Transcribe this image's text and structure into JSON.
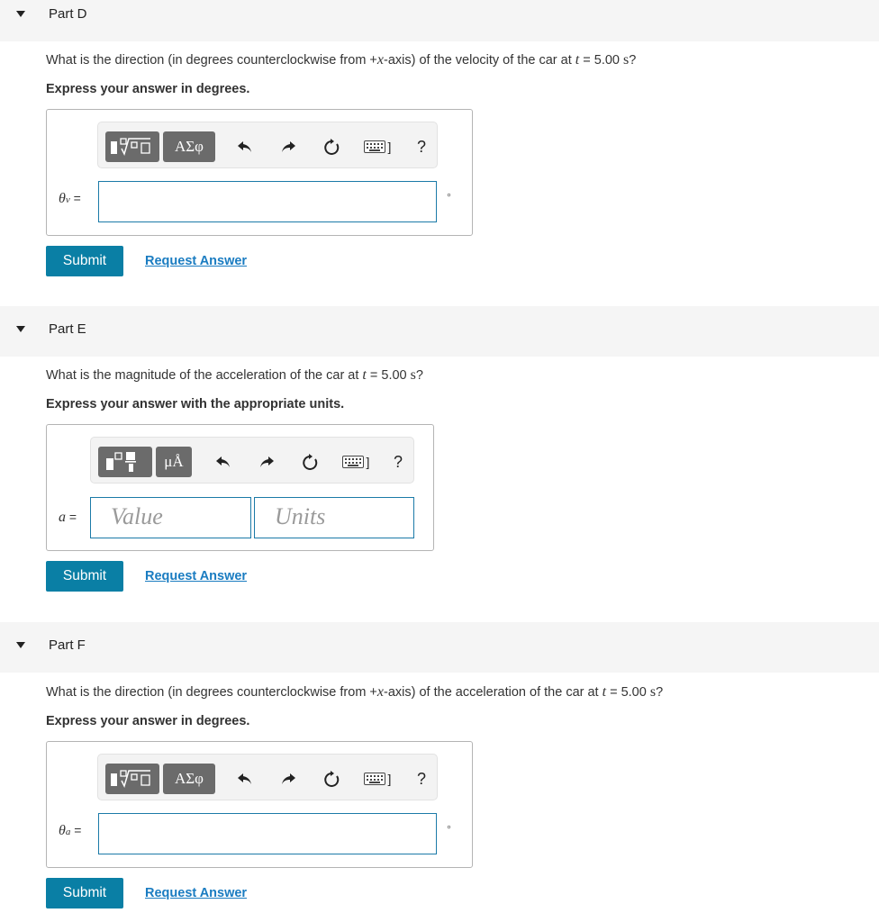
{
  "parts": {
    "d": {
      "title": "Part D",
      "question_pre": "What is the direction (in degrees counterclockwise from +",
      "question_var": "x",
      "question_mid": "-axis) of the velocity of the car at ",
      "question_t": "t",
      "question_eq": " = 5.00 ",
      "question_unit": "s",
      "question_end": "?",
      "instruction": "Express your answer in degrees.",
      "symbol_button": "ΑΣφ",
      "var_symbol": "θ",
      "var_sub": "v",
      "equals": " =",
      "unit_symbol": "∘",
      "submit": "Submit",
      "request": "Request Answer"
    },
    "e": {
      "title": "Part E",
      "question_pre": "What is the magnitude of the acceleration of the car at ",
      "question_t": "t",
      "question_eq": " = 5.00 ",
      "question_unit": "s",
      "question_end": "?",
      "instruction": "Express your answer with the appropriate units.",
      "units_button": "μÅ",
      "var_symbol": "a",
      "equals": " =",
      "value_placeholder": "Value",
      "units_placeholder": "Units",
      "submit": "Submit",
      "request": "Request Answer"
    },
    "f": {
      "title": "Part F",
      "question_pre": "What is the direction (in degrees counterclockwise from +",
      "question_var": "x",
      "question_mid": "-axis) of the acceleration of the car at ",
      "question_t": "t",
      "question_eq": " = 5.00 ",
      "question_unit": "s",
      "question_end": "?",
      "instruction": "Express your answer in degrees.",
      "symbol_button": "ΑΣφ",
      "var_symbol": "θ",
      "var_sub": "a",
      "equals": " =",
      "unit_symbol": "∘",
      "submit": "Submit",
      "request": "Request Answer"
    }
  },
  "toolbar": {
    "help": "?",
    "keyboard_bracket": "]"
  },
  "icons": [
    "caret-down-icon",
    "templates-icon",
    "undo-icon",
    "redo-icon",
    "reset-icon",
    "keyboard-icon",
    "help-icon"
  ],
  "colors": {
    "accent": "#0a7fa5",
    "link": "#1a7cc1",
    "input_border": "#1b7aa8",
    "header_bg": "#f5f5f5"
  }
}
